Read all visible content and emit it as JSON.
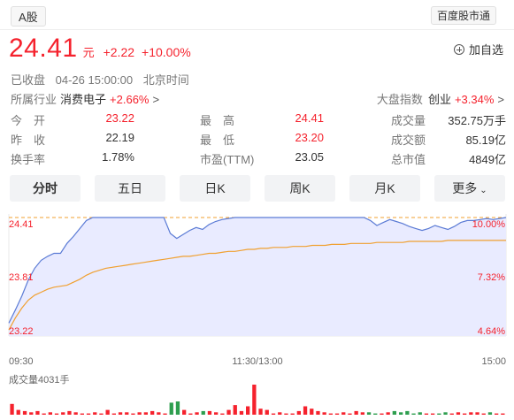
{
  "header": {
    "market_tag": "A股",
    "source_badge": "百度股市通"
  },
  "quote": {
    "price": "24.41",
    "unit": "元",
    "change": "+2.22",
    "change_pct": "+10.00%"
  },
  "add_watch": "加自选",
  "status": {
    "state": "已收盘",
    "datetime": "04-26 15:00:00",
    "timezone": "北京时间"
  },
  "industry": {
    "label": "所属行业",
    "name": "消费电子",
    "pct": "+2.66%",
    "chevron": ">"
  },
  "market_index": {
    "label": "大盘指数",
    "name": "创业",
    "pct": "+3.34%",
    "chevron": ">"
  },
  "stats": [
    [
      {
        "label": "今　开",
        "value": "23.22",
        "color": "#f5222d"
      },
      {
        "label": "最　高",
        "value": "24.41",
        "color": "#f5222d"
      },
      {
        "label": "成交量",
        "value": "352.75万手",
        "color": "#333333"
      }
    ],
    [
      {
        "label": "昨　收",
        "value": "22.19",
        "color": "#333333"
      },
      {
        "label": "最　低",
        "value": "23.20",
        "color": "#f5222d"
      },
      {
        "label": "成交额",
        "value": "85.19亿",
        "color": "#333333"
      }
    ],
    [
      {
        "label": "换手率",
        "value": "1.78%",
        "color": "#333333"
      },
      {
        "label": "市盈(TTM)",
        "value": "23.05",
        "color": "#333333"
      },
      {
        "label": "总市值",
        "value": "4849亿",
        "color": "#333333"
      }
    ]
  ],
  "tabs": [
    "分时",
    "五日",
    "日K",
    "周K",
    "月K",
    "更多"
  ],
  "chart_data": {
    "type": "line",
    "title": "",
    "x_ticks": [
      "09:30",
      "11:30/13:00",
      "15:00"
    ],
    "y_left_ticks": [
      "24.41",
      "23.81",
      "23.22"
    ],
    "y_right_ticks": [
      "10.00%",
      "7.32%",
      "4.64%"
    ],
    "ylim": [
      23.22,
      24.41
    ],
    "limit_up_line": 24.41,
    "series": [
      {
        "values": [
          23.35,
          23.48,
          23.62,
          23.78,
          23.9,
          23.98,
          24.02,
          24.05,
          24.05,
          24.15,
          24.22,
          24.3,
          24.38,
          24.41,
          24.41,
          24.41,
          24.41,
          24.41,
          24.41,
          24.41,
          24.41,
          24.41,
          24.41,
          24.41,
          24.41,
          24.25,
          24.2,
          24.24,
          24.28,
          24.31,
          24.29,
          24.34,
          24.37,
          24.39,
          24.4,
          24.41,
          24.41,
          24.41,
          24.41,
          24.41,
          24.41,
          24.41,
          24.41,
          24.41,
          24.41,
          24.41,
          24.41,
          24.41,
          24.41,
          24.41,
          24.41,
          24.41,
          24.41,
          24.41,
          24.41,
          24.41,
          24.38,
          24.33,
          24.36,
          24.39,
          24.37,
          24.35,
          24.32,
          24.3,
          24.28,
          24.3,
          24.33,
          24.31,
          24.29,
          24.32,
          24.36,
          24.38,
          24.38,
          24.39,
          24.4,
          24.39,
          24.4,
          24.41
        ]
      },
      {
        "values": [
          23.28,
          23.4,
          23.5,
          23.58,
          23.63,
          23.66,
          23.69,
          23.71,
          23.72,
          23.73,
          23.76,
          23.79,
          23.83,
          23.86,
          23.88,
          23.9,
          23.91,
          23.92,
          23.93,
          23.94,
          23.95,
          23.96,
          23.97,
          23.98,
          23.99,
          24.0,
          24.01,
          24.02,
          24.02,
          24.03,
          24.04,
          24.05,
          24.05,
          24.06,
          24.07,
          24.07,
          24.08,
          24.09,
          24.09,
          24.1,
          24.1,
          24.11,
          24.11,
          24.11,
          24.12,
          24.12,
          24.12,
          24.13,
          24.13,
          24.13,
          24.14,
          24.14,
          24.14,
          24.15,
          24.15,
          24.15,
          24.15,
          24.16,
          24.16,
          24.16,
          24.16,
          24.16,
          24.17,
          24.17,
          24.17,
          24.17,
          24.17,
          24.17,
          24.18,
          24.18,
          24.18,
          24.18,
          24.18,
          24.18,
          24.18,
          24.18,
          24.18,
          24.18
        ]
      }
    ],
    "volume_label": "成交量4031手",
    "volume": [
      9,
      4,
      3,
      2,
      3,
      1,
      2,
      1,
      2,
      3,
      2,
      1,
      1,
      2,
      1,
      4,
      1,
      2,
      2,
      1,
      2,
      2,
      3,
      2,
      1,
      10,
      11,
      4,
      1,
      2,
      3,
      3,
      2,
      1,
      4,
      8,
      3,
      7,
      25,
      5,
      4,
      1,
      2,
      1,
      1,
      3,
      7,
      5,
      3,
      2,
      1,
      1,
      2,
      1,
      3,
      2,
      2,
      1,
      1,
      2,
      3,
      2,
      3,
      1,
      2,
      1,
      1,
      1,
      2,
      1,
      2,
      1,
      2,
      2,
      1,
      2,
      1,
      1
    ],
    "volume_colors": [
      "#f5222d",
      "#2e9e4f"
    ]
  }
}
